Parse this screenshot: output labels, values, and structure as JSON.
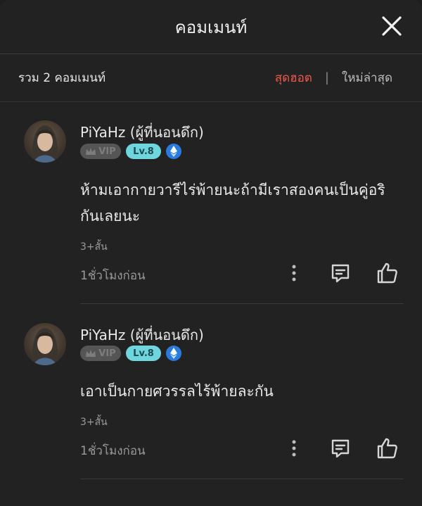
{
  "header": {
    "title": "คอมเมนท์"
  },
  "subbar": {
    "total": "รวม 2 คอมเมนท์",
    "sort_hot": "สุดฮอต",
    "separator": "|",
    "sort_new": "ใหม่ล่าสุด"
  },
  "colors": {
    "accent_red": "#f0574a",
    "level_badge": "#6fd6dd",
    "eth_badge": "#2a7be0"
  },
  "comments": [
    {
      "username": "PiYaHz (ผู้ที่นอนดึก)",
      "vip": "VIP",
      "level": "Lv.8",
      "text": "ห้ามเอากายวารีไร่พ้ายนะถ้ามีเราสองคนเป็นคู่อริกันเลยนะ",
      "more": "3+สั้น",
      "time": "1ชั่วโมงก่อน"
    },
    {
      "username": "PiYaHz (ผู้ที่นอนดึก)",
      "vip": "VIP",
      "level": "Lv.8",
      "text": "เอาเป็นกายศวรรลไร้พ้ายละกัน",
      "more": "3+สั้น",
      "time": "1ชั่วโมงก่อน"
    }
  ]
}
